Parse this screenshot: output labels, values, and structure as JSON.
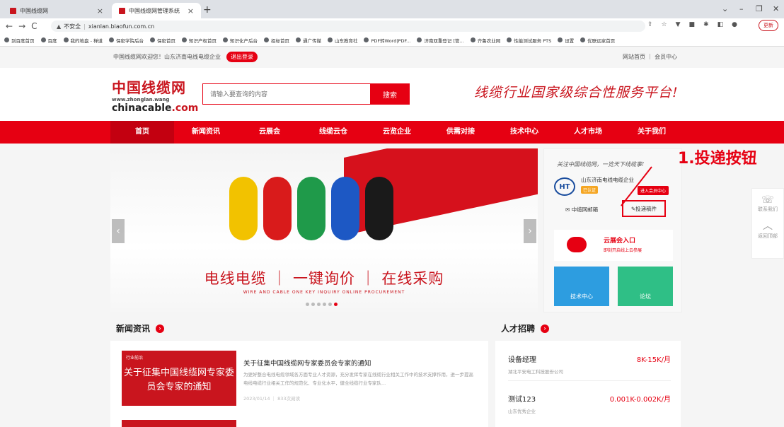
{
  "browser": {
    "tabs": [
      {
        "title": "中国线缆网"
      },
      {
        "title": "中国线缆网管理系统"
      }
    ],
    "url_warning": "不安全",
    "url": "xianlan.biaofun.com.cn",
    "update_label": "更新",
    "bookmarks": [
      "到百度首页",
      "百度",
      "我的地盘 - 禅道",
      "保密学院后台",
      "保密首页",
      "知识产权首页",
      "知识化产后台",
      "招标首页",
      "通广传媒",
      "山东教育社",
      "PDF转Word|PDF...",
      "济南双重登记 [管...",
      "齐鲁农业网",
      "性能测试服务 PTS",
      "设置",
      "优联远家首页"
    ]
  },
  "site": {
    "welcome": "中国线缆网欢迎您！山东济南电线电缆企业",
    "logout": "退出登录",
    "top_links": "网站首页 ｜ 会员中心",
    "logo": {
      "cn": "中国线缆网",
      "www": "www.zhonglan.wang",
      "en_a": "chinacable",
      "en_b": ".com"
    },
    "search_placeholder": "请输入要查询的内容",
    "search_button": "搜索",
    "slogan": "线缆行业国家级综合性服务平台!",
    "nav": [
      "首页",
      "新闻资讯",
      "云展会",
      "线缆云仓",
      "云览企业",
      "供需对接",
      "技术中心",
      "人才市场",
      "关于我们"
    ],
    "banner": {
      "main": "电线电缆 ｜ 一键询价 ｜ 在线采购",
      "sub": "WIRE AND CABLE ONE KEY INQUIRY ONLINE PROCUREMENT"
    },
    "side": {
      "follow": "关注中国线缆网，一览天下线缆事!",
      "logo_text": "HT",
      "company": "山东济南电线电缆企业",
      "certified": "已认证",
      "member_center": "进入会员中心",
      "mailbox": "中缆网邮箱",
      "submit": "投递稿件",
      "expo_title": "云展会入口",
      "expo_sub": "即刻开启线上云参展",
      "tile_tech": "技术中心",
      "tile_forum": "论坛"
    },
    "annotation": "1.投递按钮",
    "float": {
      "contact": "联系我们",
      "top": "返回顶部"
    },
    "news": {
      "heading": "新闻资讯",
      "img_tag": "行业前沿",
      "img_text": "关于征集中国线缆网专家委员会专家的通知",
      "title": "关于征集中国线缆网专家委员会专家的通知",
      "desc": "为更好整合电线电缆领域各方面专业人才资源，充分发挥专家在线缆行业相关工作中的技术支撑作用，进一步提高电线电缆行业相关工作的规范化、专业化水平，健全线缆行业专家队...",
      "meta": "2023/01/14 ｜ 833次阅读"
    },
    "jobs": {
      "heading": "人才招聘",
      "items": [
        {
          "title": "设备经理",
          "salary": "8K-15K/月",
          "company": "湖北平安电工科技股份公司"
        },
        {
          "title": "测试123",
          "salary": "0.001K-0.002K/月",
          "company": "山东优秀企业"
        }
      ]
    }
  }
}
